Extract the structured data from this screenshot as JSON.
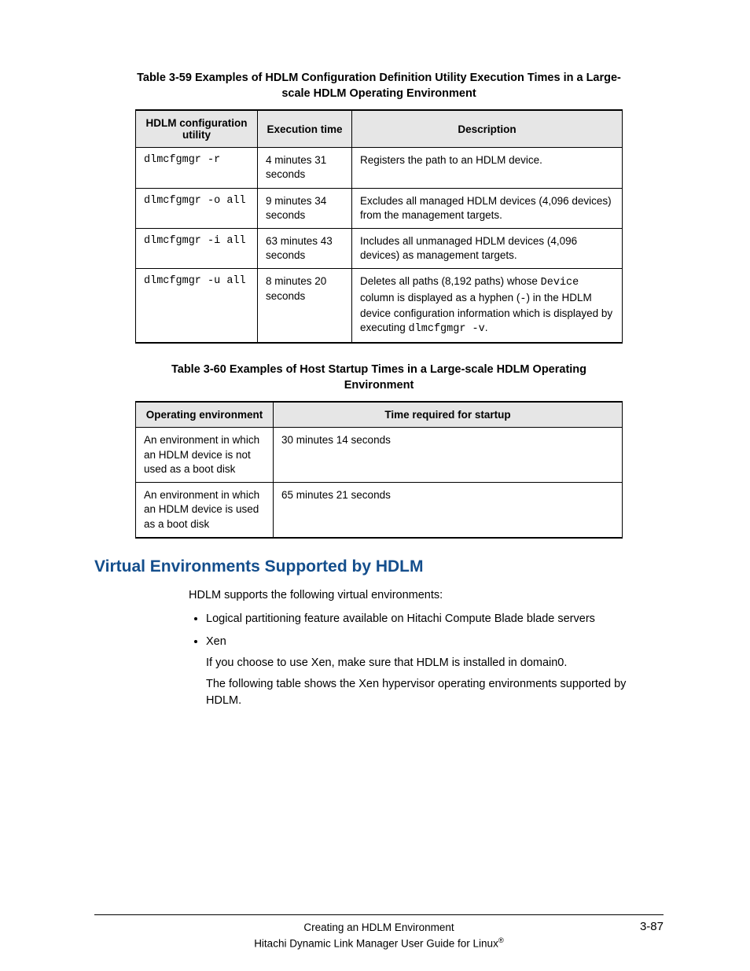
{
  "table59": {
    "caption": "Table 3-59 Examples of HDLM Configuration Definition Utility Execution Times in a Large-scale HDLM Operating Environment",
    "headers": {
      "col1": "HDLM configuration utility",
      "col2": "Execution time",
      "col3": "Description"
    },
    "rows": [
      {
        "utility": "dlmcfgmgr -r",
        "time": "4 minutes 31 seconds",
        "desc": "Registers the path to an HDLM device."
      },
      {
        "utility": "dlmcfgmgr -o all",
        "time": "9 minutes 34 seconds",
        "desc": "Excludes all managed HDLM devices (4,096 devices) from the management targets."
      },
      {
        "utility": "dlmcfgmgr -i all",
        "time": "63 minutes 43 seconds",
        "desc": "Includes all unmanaged HDLM devices (4,096 devices) as management targets."
      },
      {
        "utility": "dlmcfgmgr -u all",
        "time": "8 minutes 20 seconds",
        "desc_pre": "Deletes all paths (8,192 paths) whose ",
        "desc_code1": "Device",
        "desc_mid": " column is displayed as a hyphen (",
        "desc_code2": "-",
        "desc_mid2": ") in the HDLM device configuration information which is displayed by executing ",
        "desc_code3": "dlmcfgmgr -v",
        "desc_post": "."
      }
    ]
  },
  "table60": {
    "caption": "Table 3-60 Examples of Host Startup Times in a Large-scale HDLM Operating Environment",
    "headers": {
      "col1": "Operating environment",
      "col2": "Time required for startup"
    },
    "rows": [
      {
        "env": "An environment in which an HDLM device is not used as a boot disk",
        "time": "30 minutes 14 seconds"
      },
      {
        "env": "An environment in which an HDLM device is used as a boot disk",
        "time": "65 minutes 21 seconds"
      }
    ]
  },
  "section": {
    "heading": "Virtual Environments Supported by HDLM",
    "intro": "HDLM supports the following virtual environments:",
    "bullet1": "Logical partitioning feature available on Hitachi Compute Blade blade servers",
    "bullet2": "Xen",
    "bullet2_sub1": "If you choose to use Xen, make sure that HDLM is installed in domain0.",
    "bullet2_sub2": "The following table shows the Xen hypervisor operating environments supported by HDLM."
  },
  "footer": {
    "line1": "Creating an HDLM Environment",
    "line2_pre": "Hitachi Dynamic Link Manager User Guide for Linux",
    "page_number": "3-87"
  }
}
